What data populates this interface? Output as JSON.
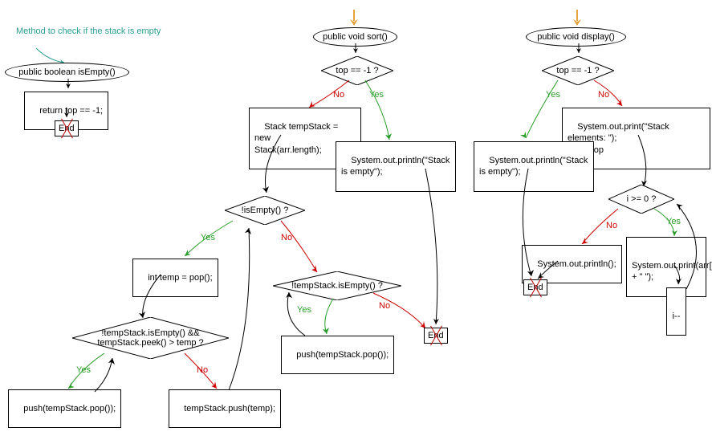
{
  "comment": "Method to check if\nthe stack is empty",
  "flowchart1": {
    "terminal": "public boolean isEmpty()",
    "process1": "return top == -1;",
    "end": "End"
  },
  "flowchart2": {
    "terminal": "public void sort()",
    "decision1": "top == -1 ?",
    "process_no1": "Stack tempStack = new\nStack(arr.length);",
    "process_yes1": "System.out.println(\"Stack\nis empty\");",
    "decision2": "!isEmpty() ?",
    "process_yes2": "int temp = pop();",
    "decision3": "!tempStack.isEmpty() &&\ntempStack.peek() > temp ?",
    "process_yes3": "push(tempStack.pop());",
    "process_no3": "tempStack.push(temp);",
    "decision4": "!tempStack.isEmpty() ?",
    "process_yes4": "push(tempStack.pop());",
    "end": "End"
  },
  "flowchart3": {
    "terminal": "public void display()",
    "decision1": "top == -1 ?",
    "process_yes1": "System.out.println(\"Stack\nis empty\");",
    "process_no1": "System.out.print(\"Stack elements: \");\nint i = top",
    "decision2": "i >= 0 ?",
    "process_yes2": "System.out.print(arr[i]\n+ \" \");",
    "process_no2": "System.out.println();",
    "process_i": "i--",
    "end": "End"
  },
  "labels": {
    "yes": "Yes",
    "no": "No"
  }
}
